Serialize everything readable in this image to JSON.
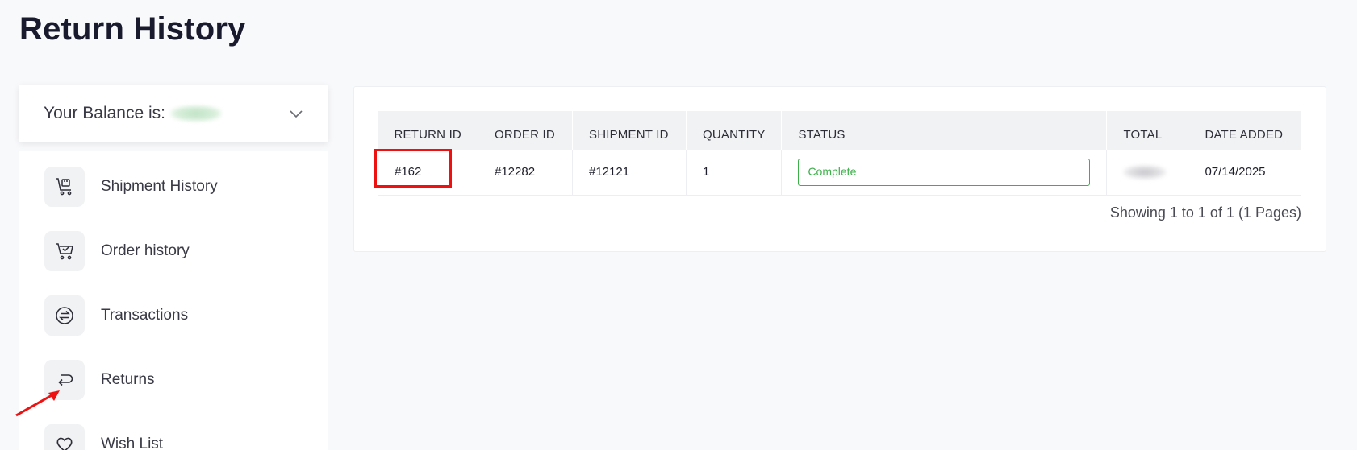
{
  "page": {
    "title": "Return History"
  },
  "balance": {
    "label": "Your Balance is:"
  },
  "sidebar": {
    "items": [
      {
        "label": "Shipment History",
        "icon": "shipment-cart-icon"
      },
      {
        "label": "Order history",
        "icon": "cart-check-icon"
      },
      {
        "label": "Transactions",
        "icon": "exchange-icon"
      },
      {
        "label": "Returns",
        "icon": "return-arrow-icon"
      },
      {
        "label": "Wish List",
        "icon": "heart-icon"
      }
    ]
  },
  "table": {
    "headers": [
      "RETURN ID",
      "ORDER ID",
      "SHIPMENT ID",
      "QUANTITY",
      "STATUS",
      "TOTAL",
      "DATE ADDED"
    ],
    "rows": [
      {
        "return_id": "#162",
        "order_id": "#12282",
        "shipment_id": "#12121",
        "quantity": "1",
        "status": "Complete",
        "date_added": "07/14/2025"
      }
    ]
  },
  "pagination": {
    "text": "Showing 1 to 1 of 1 (1 Pages)"
  },
  "colors": {
    "status_complete": "#3db04a",
    "annotation_red": "#ee1111",
    "background": "#f8f9fb"
  }
}
